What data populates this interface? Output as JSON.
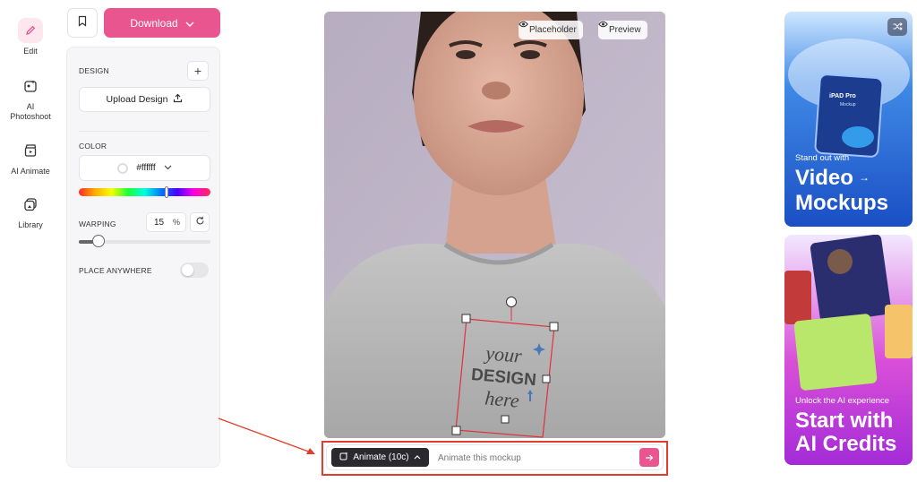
{
  "nav": {
    "items": [
      {
        "label": "Edit",
        "icon": "pencil-icon",
        "active": true
      },
      {
        "label": "AI Photoshoot",
        "icon": "ai-photo-icon",
        "active": false
      },
      {
        "label": "AI Animate",
        "icon": "clapper-icon",
        "active": false
      },
      {
        "label": "Library",
        "icon": "library-icon",
        "active": false
      }
    ]
  },
  "toolbar": {
    "bookmark_icon": "bookmark-icon",
    "download_label": "Download"
  },
  "panel": {
    "design_label": "DESIGN",
    "upload_label": "Upload Design",
    "color_label": "COLOR",
    "color_value": "#ffffff",
    "warping_label": "WARPING",
    "warping_value": "15",
    "warping_unit": "%",
    "warping_fraction": 0.15,
    "place_anywhere_label": "PLACE ANYWHERE",
    "place_anywhere_on": false
  },
  "canvas": {
    "placeholder_label": "Placeholder",
    "preview_label": "Preview",
    "design_text": [
      "your",
      "DESIGN",
      "here"
    ]
  },
  "animate": {
    "button_label": "Animate (10c)",
    "placeholder": "Animate this mockup"
  },
  "ads": [
    {
      "subtitle": "Stand out with",
      "title_lines": [
        "Video",
        "Mockups"
      ],
      "device_label": "iPAD Pro",
      "device_sub": "Mockup"
    },
    {
      "subtitle": "Unlock the AI experience",
      "title_lines": [
        "Start with",
        "AI Credits"
      ]
    }
  ],
  "colors": {
    "brand_pink": "#e8558f",
    "annotation_red": "#e23c2a"
  }
}
